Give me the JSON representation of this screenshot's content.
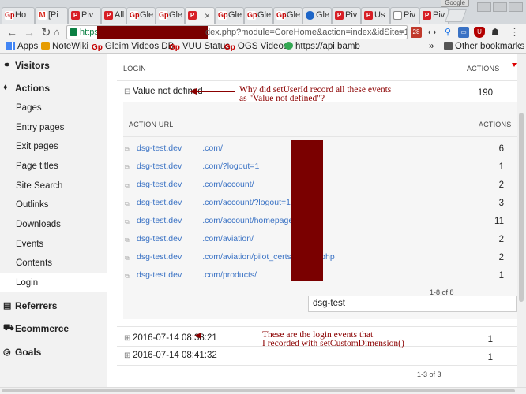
{
  "browser": {
    "tabs": [
      {
        "icon": "gp-icon",
        "label": "Ho"
      },
      {
        "icon": "gmail-icon",
        "label": "[Pi"
      },
      {
        "icon": "piwik-icon",
        "label": "Piv"
      },
      {
        "icon": "piwik-icon",
        "label": "All"
      },
      {
        "icon": "gp-icon",
        "label": "Gle"
      },
      {
        "icon": "gp-icon",
        "label": "Gle"
      },
      {
        "icon": "piwik-icon",
        "label": ""
      },
      {
        "icon": "gp-icon",
        "label": "Gle"
      },
      {
        "icon": "gp-icon",
        "label": "Gle"
      },
      {
        "icon": "gp-icon",
        "label": "Gle"
      },
      {
        "icon": "chrome-icon",
        "label": "Gle"
      },
      {
        "icon": "piwik-icon",
        "label": "Piv"
      },
      {
        "icon": "piwik-icon",
        "label": "Us"
      },
      {
        "icon": "doc-icon",
        "label": "Piv"
      },
      {
        "icon": "piwik-icon",
        "label": "Piv"
      }
    ],
    "window_label": "Google",
    "url_scheme": "https",
    "url_visible": "dex.php?module=CoreHome&action=index&idSite=1&per",
    "ext_badge": "28"
  },
  "bookmarks": [
    {
      "label": "Apps",
      "icon": "apps-icon"
    },
    {
      "label": "NoteWiki",
      "icon": "notewiki-icon"
    },
    {
      "label": "Gleim Videos DB",
      "icon": "gp-icon"
    },
    {
      "label": "VUU Status",
      "icon": "gp-icon"
    },
    {
      "label": "OGS Videos",
      "icon": "gp-icon"
    },
    {
      "label": "https://api.bamb",
      "icon": "globe-icon"
    },
    {
      "label": "»",
      "icon": ""
    },
    {
      "label": "Other bookmarks",
      "icon": "folder-icon"
    }
  ],
  "sidebar": {
    "visitors": "Visitors",
    "actions": "Actions",
    "action_items": [
      "Pages",
      "Entry pages",
      "Exit pages",
      "Page titles",
      "Site Search",
      "Outlinks",
      "Downloads",
      "Events",
      "Contents",
      "Login"
    ],
    "referrers": "Referrers",
    "ecommerce": "Ecommerce",
    "goals": "Goals"
  },
  "report": {
    "col_login": "LOGIN",
    "col_actions": "ACTIONS",
    "row1_label": "Value not defined",
    "row1_value": "190",
    "sub_col_url": "ACTION URL",
    "sub_col_actions": "ACTIONS",
    "sub_rows": [
      {
        "prefix": "dsg-test.dev",
        "suffix": ".com/",
        "value": "6"
      },
      {
        "prefix": "dsg-test.dev",
        "suffix": ".com/?logout=1",
        "value": "1"
      },
      {
        "prefix": "dsg-test.dev",
        "suffix": ".com/account/",
        "value": "2"
      },
      {
        "prefix": "dsg-test.dev",
        "suffix": ".com/account/?logout=1",
        "value": "3"
      },
      {
        "prefix": "dsg-test.dev",
        "suffix": ".com/account/homepage.php",
        "value": "11"
      },
      {
        "prefix": "dsg-test.dev",
        "suffix": ".com/aviation/",
        "value": "2"
      },
      {
        "prefix": "dsg-test.dev",
        "suffix": ".com/aviation/pilot_certs/private.php",
        "value": "2"
      },
      {
        "prefix": "dsg-test.dev",
        "suffix": ".com/products/",
        "value": "1"
      }
    ],
    "sub_paging": "1-8 of 8",
    "sub_search_value": "dsg-test",
    "row2_label": "2016-07-14 08:38:21",
    "row2_value": "1",
    "row3_label": "2016-07-14 08:41:32",
    "row3_value": "1",
    "paging": "1-3 of 3"
  },
  "annotations": {
    "note1_line1": "Why did setUserId record all these events",
    "note1_line2": "as \"Value not defined\"?",
    "note2_line1": "These are the login events that",
    "note2_line2": "I recorded with setCustomDimension()"
  },
  "colors": {
    "annotation": "#8b0000",
    "redaction": "#7a0000",
    "link": "#3a72c4"
  }
}
